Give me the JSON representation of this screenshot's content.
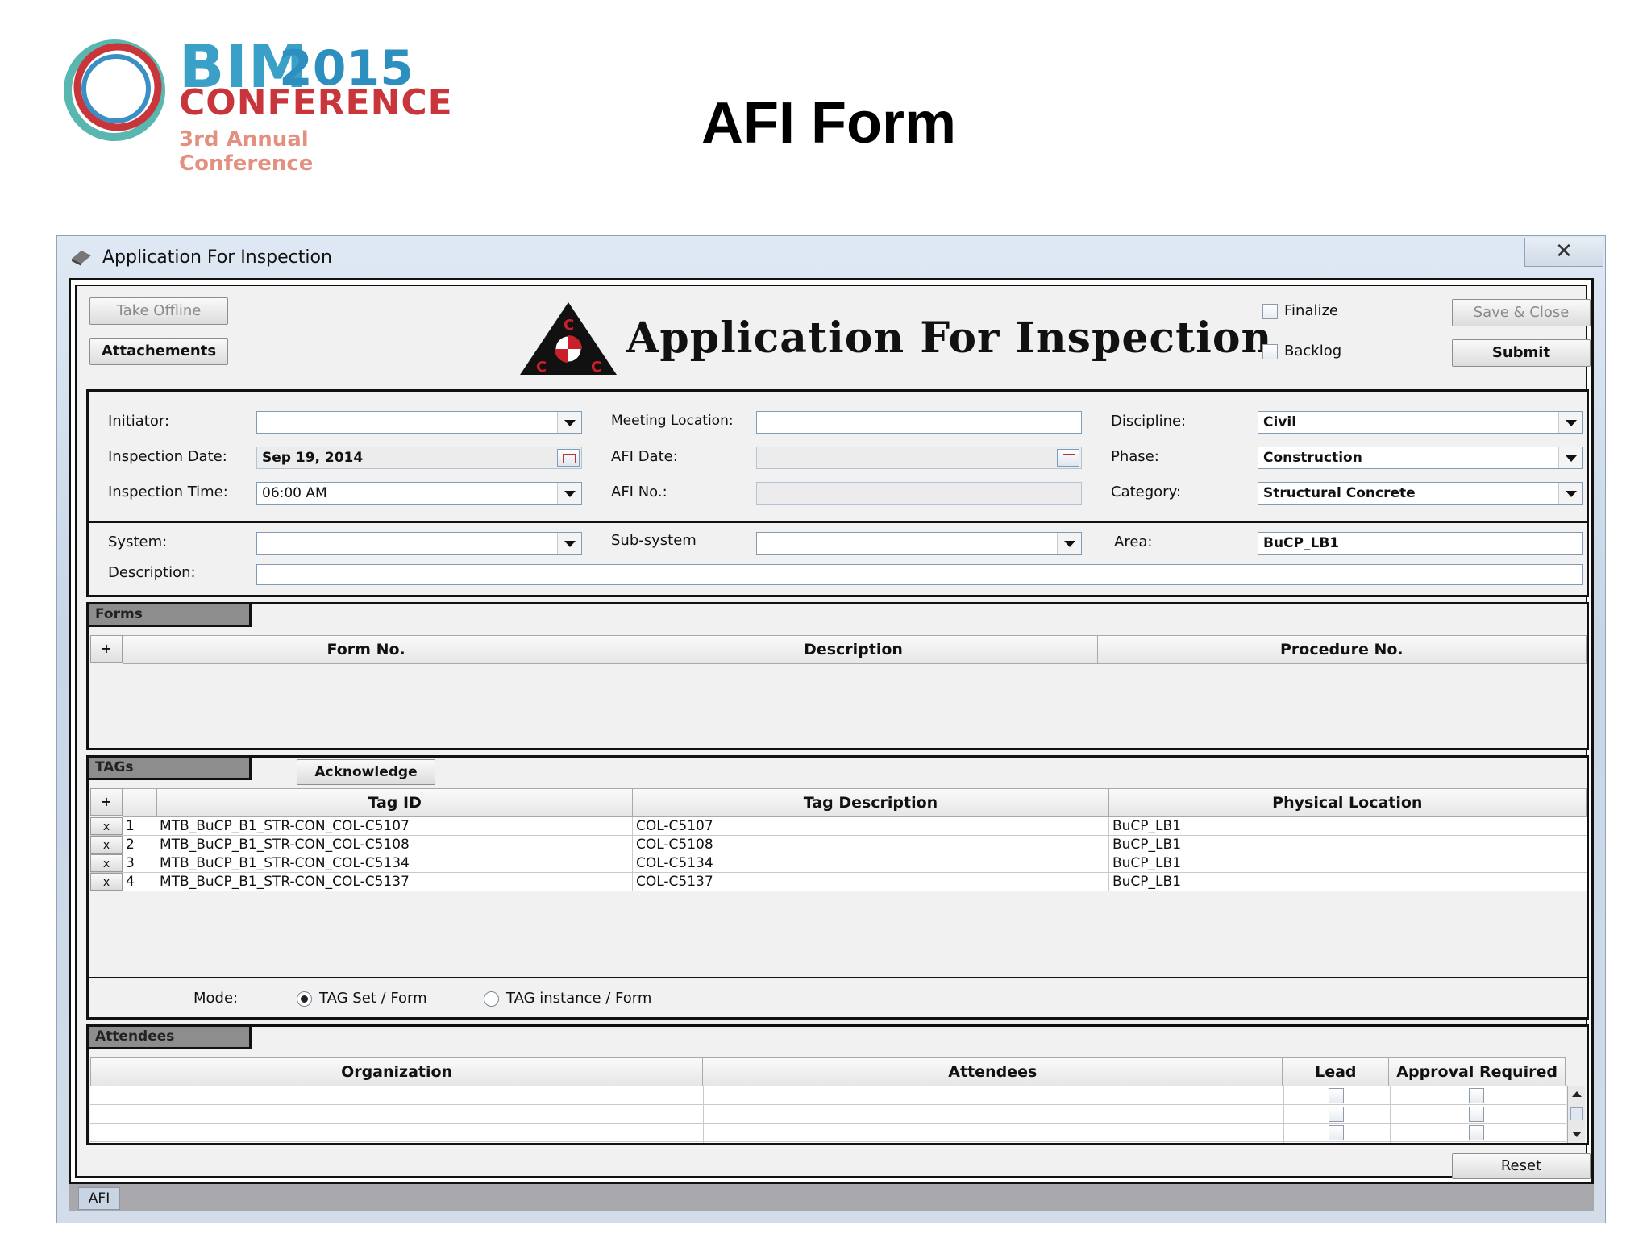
{
  "slide": {
    "logo": {
      "bim": "BIM",
      "year": "2015",
      "conference": "CONFERENCE",
      "sub": "3rd Annual Conference"
    },
    "title": "AFI Form"
  },
  "window": {
    "title": "Application For Inspection",
    "close_glyph": "✕",
    "status_tab": "AFI"
  },
  "header": {
    "take_offline": "Take Offline",
    "attachments": "Attachements",
    "form_title": "Application For Inspection",
    "finalize": "Finalize",
    "backlog": "Backlog",
    "save_close": "Save & Close",
    "submit": "Submit"
  },
  "fields": {
    "initiator": {
      "label": "Initiator:",
      "value": ""
    },
    "inspection_date": {
      "label": "Inspection Date:",
      "value": "Sep 19, 2014"
    },
    "inspection_time": {
      "label": "Inspection Time:",
      "value": "06:00 AM"
    },
    "meeting_location": {
      "label": "Meeting Location:",
      "value": ""
    },
    "afi_date": {
      "label": "AFI Date:",
      "value": ""
    },
    "afi_no": {
      "label": "AFI No.:",
      "value": ""
    },
    "discipline": {
      "label": "Discipline:",
      "value": "Civil"
    },
    "phase": {
      "label": "Phase:",
      "value": "Construction"
    },
    "category": {
      "label": "Category:",
      "value": "Structural Concrete"
    },
    "system": {
      "label": "System:",
      "value": ""
    },
    "subsystem": {
      "label": "Sub-system",
      "value": ""
    },
    "area": {
      "label": "Area:",
      "value": "BuCP_LB1"
    },
    "description": {
      "label": "Description:",
      "value": ""
    }
  },
  "forms": {
    "tab": "Forms",
    "add": "+",
    "columns": [
      "Form No.",
      "Description",
      "Procedure No."
    ]
  },
  "tags": {
    "tab": "TAGs",
    "acknowledge": "Acknowledge",
    "add": "+",
    "columns": [
      "Tag ID",
      "Tag Description",
      "Physical Location"
    ],
    "rows": [
      {
        "x": "x",
        "n": "1",
        "id": "MTB_BuCP_B1_STR-CON_COL-C5107",
        "desc": "COL-C5107",
        "loc": "BuCP_LB1"
      },
      {
        "x": "x",
        "n": "2",
        "id": "MTB_BuCP_B1_STR-CON_COL-C5108",
        "desc": "COL-C5108",
        "loc": "BuCP_LB1"
      },
      {
        "x": "x",
        "n": "3",
        "id": "MTB_BuCP_B1_STR-CON_COL-C5134",
        "desc": "COL-C5134",
        "loc": "BuCP_LB1"
      },
      {
        "x": "x",
        "n": "4",
        "id": "MTB_BuCP_B1_STR-CON_COL-C5137",
        "desc": "COL-C5137",
        "loc": "BuCP_LB1"
      }
    ],
    "mode_label": "Mode:",
    "mode_options": [
      "TAG Set / Form",
      "TAG instance / Form"
    ],
    "mode_selected": "TAG Set / Form"
  },
  "attendees": {
    "tab": "Attendees",
    "columns": [
      "Organization",
      "Attendees",
      "Lead",
      "Approval Required"
    ]
  },
  "footer": {
    "reset": "Reset"
  },
  "colors": {
    "window_bg": "#dfe9f4",
    "panel_bg": "#f1f1f1",
    "tab_gray": "#8d8d8d",
    "field_border": "#7f9db9"
  }
}
